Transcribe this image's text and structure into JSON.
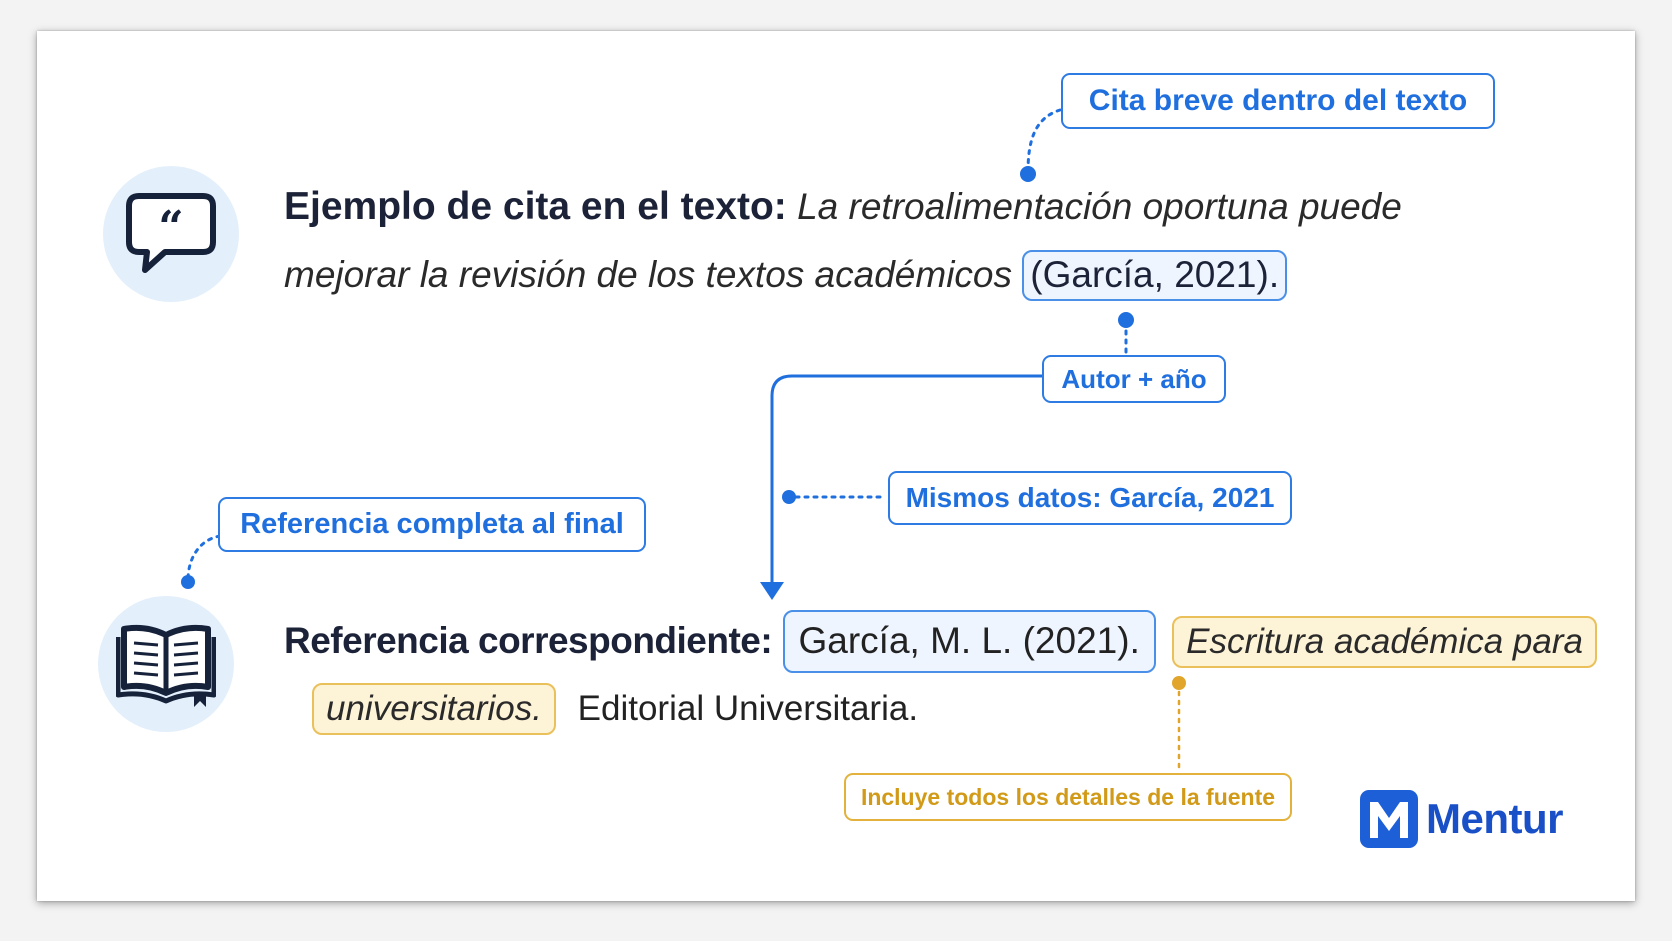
{
  "labels": {
    "short_citation": "Cita breve dentro del texto",
    "author_year": "Autor + año",
    "same_data": "Mismos datos: García, 2021",
    "full_reference": "Referencia completa al final",
    "all_details": "Incluye todos los detalles de la fuente"
  },
  "citation_example": {
    "lead": "Ejemplo de cita en el texto:",
    "text_part1": "La retroalimentación oportuna puede",
    "text_part2": "mejorar la revisión de los textos académicos",
    "highlight": "(García, 2021)."
  },
  "reference": {
    "lead": "Referencia correspondiente:",
    "author_year": "García, M. L. (2021).",
    "title_part1": "Escritura académica para",
    "title_part2": "universitarios.",
    "publisher": "Editorial Universitaria."
  },
  "brand": {
    "name": "Mentur"
  },
  "icons": {
    "quote": "speech-bubble-quote-icon",
    "book": "open-book-icon",
    "logo": "mentur-m-logo"
  },
  "colors": {
    "blue": "#1f6fde",
    "gold": "#e0a52a",
    "circle_bg": "#e3effb"
  }
}
